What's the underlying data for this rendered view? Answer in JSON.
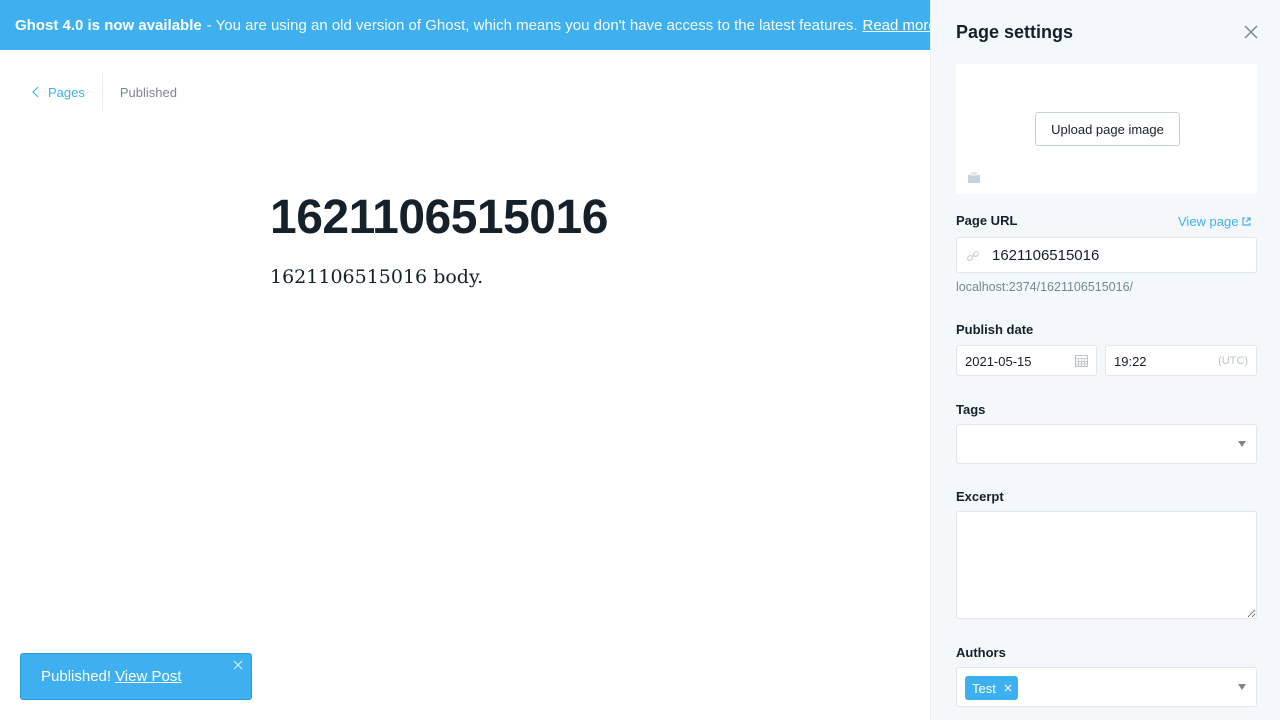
{
  "banner": {
    "strong": "Ghost 4.0 is now available",
    "message": "- You are using an old version of Ghost, which means you don't have access to the latest features.",
    "link": "Read more!"
  },
  "editor": {
    "back_label": "Pages",
    "status": "Published",
    "title": "1621106515016",
    "body": "1621106515016 body."
  },
  "toast": {
    "message": "Published!",
    "link": "View Post"
  },
  "settings": {
    "title": "Page settings",
    "upload_label": "Upload page image",
    "url_label": "Page URL",
    "view_page": "View page",
    "url_value": "1621106515016",
    "url_help": "localhost:2374/1621106515016/",
    "publish_label": "Publish date",
    "date_value": "2021-05-15",
    "time_value": "19:22",
    "timezone": "(UTC)",
    "tags_label": "Tags",
    "excerpt_label": "Excerpt",
    "authors_label": "Authors",
    "authors": [
      "Test"
    ]
  },
  "colors": {
    "accent": "#3eb0ef",
    "text": "#15212a",
    "muted": "#7d878a",
    "panel_bg": "#f4f8fb"
  }
}
